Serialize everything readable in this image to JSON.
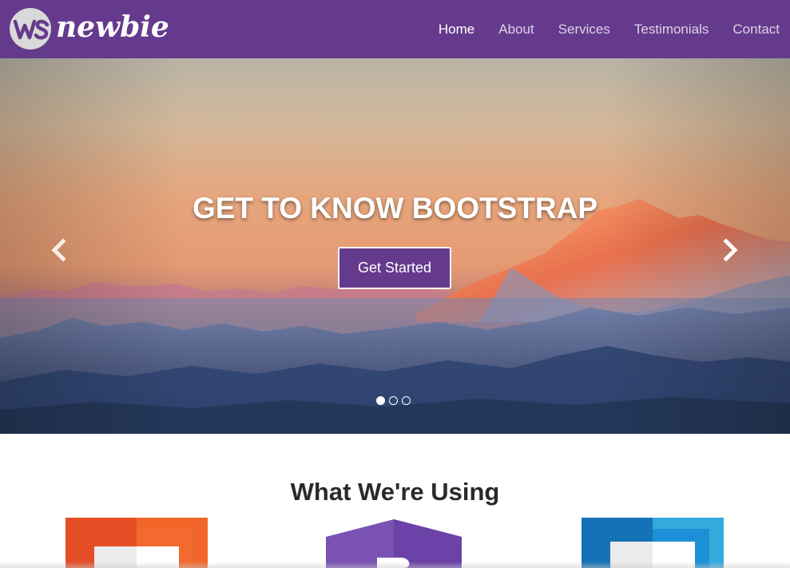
{
  "brand": {
    "name": "newbie",
    "logo_icon": "ws-logo-icon",
    "colors": {
      "primary": "#653a8c",
      "nav_text": "#dcd2e6",
      "white": "#ffffff"
    }
  },
  "nav": {
    "items": [
      {
        "label": "Home",
        "active": true
      },
      {
        "label": "About",
        "active": false
      },
      {
        "label": "Services",
        "active": false
      },
      {
        "label": "Testimonials",
        "active": false
      },
      {
        "label": "Contact",
        "active": false
      }
    ]
  },
  "hero": {
    "title": "GET TO KNOW BOOTSTRAP",
    "button_label": "Get Started",
    "prev_icon": "chevron-left-icon",
    "next_icon": "chevron-right-icon",
    "slides_count": 3,
    "active_slide": 1
  },
  "section": {
    "title": "What We're Using",
    "logos": [
      {
        "icon": "html5-logo-icon",
        "color": "#e44d26"
      },
      {
        "icon": "bootstrap-logo-icon",
        "color": "#7952b3"
      },
      {
        "icon": "css3-logo-icon",
        "color": "#1572b6"
      }
    ]
  }
}
